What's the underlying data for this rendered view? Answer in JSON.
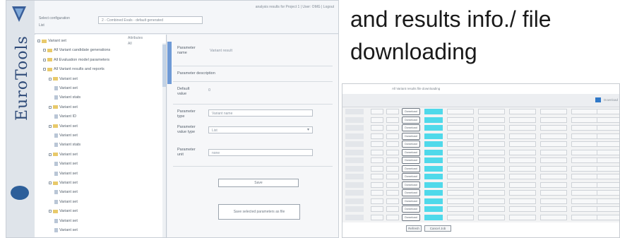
{
  "headline": {
    "line1": "and results info./ file",
    "line2": "downloading"
  },
  "left_screenshot": {
    "brand_name": "EuroTools",
    "top_status": "analysis results for Project 1 | User: OMG | Logout",
    "top_label": "Select configuration",
    "top_label2": "List",
    "top_select_value": "2 - Combined Evals - default generated",
    "tree_col_label": "Attributes",
    "tree_col_value": "All",
    "tree_items": [
      {
        "label": "Variant set",
        "level": 0,
        "icon": "folder"
      },
      {
        "label": "All Variant candidate generations",
        "level": 1,
        "icon": "folder"
      },
      {
        "label": "All Evaluation model parameters",
        "level": 1,
        "icon": "folder"
      },
      {
        "label": "All Variant results and reports",
        "level": 1,
        "icon": "folder"
      },
      {
        "label": "Variant set",
        "level": 2,
        "icon": "folder"
      },
      {
        "label": "Variant set",
        "level": 3,
        "icon": "doc"
      },
      {
        "label": "Variant stats",
        "level": 3,
        "icon": "doc"
      },
      {
        "label": "Variant set",
        "level": 2,
        "icon": "folder"
      },
      {
        "label": "Variant ID",
        "level": 3,
        "icon": "doc"
      },
      {
        "label": "Variant set",
        "level": 2,
        "icon": "folder"
      },
      {
        "label": "Variant set",
        "level": 3,
        "icon": "doc"
      },
      {
        "label": "Variant stats",
        "level": 3,
        "icon": "doc"
      },
      {
        "label": "Variant set",
        "level": 2,
        "icon": "folder"
      },
      {
        "label": "Variant set",
        "level": 3,
        "icon": "doc"
      },
      {
        "label": "Variant set",
        "level": 3,
        "icon": "doc"
      },
      {
        "label": "Variant set",
        "level": 2,
        "icon": "folder"
      },
      {
        "label": "Variant set",
        "level": 3,
        "icon": "doc"
      },
      {
        "label": "Variant set",
        "level": 3,
        "icon": "doc"
      },
      {
        "label": "Variant set",
        "level": 2,
        "icon": "folder"
      },
      {
        "label": "Variant set",
        "level": 3,
        "icon": "doc"
      },
      {
        "label": "Variant set",
        "level": 3,
        "icon": "doc"
      }
    ],
    "detail": {
      "field1_label": "Parameter name",
      "field1_value": "Variant result",
      "field2_label": "Parameter description",
      "field3_label": "Default value",
      "field3_value": "0",
      "field4_label": "Parameter type",
      "field4_value": "Variant name",
      "field5_label": "Parameter value type",
      "field5_value": "List",
      "field6_label": "Parameter unit",
      "field6_value": "none",
      "button1": "Save",
      "button2": "Save selected parameters as file"
    }
  },
  "right_screenshot": {
    "title": "All Variant results file downloading",
    "toolbar_text": "Download",
    "row_button_label": "Download",
    "rows": 14,
    "footer_button1": "Refresh",
    "footer_button2": "Cancel Job",
    "colors": {
      "highlight": "#4fd9ea",
      "accent": "#2f78c8"
    }
  }
}
